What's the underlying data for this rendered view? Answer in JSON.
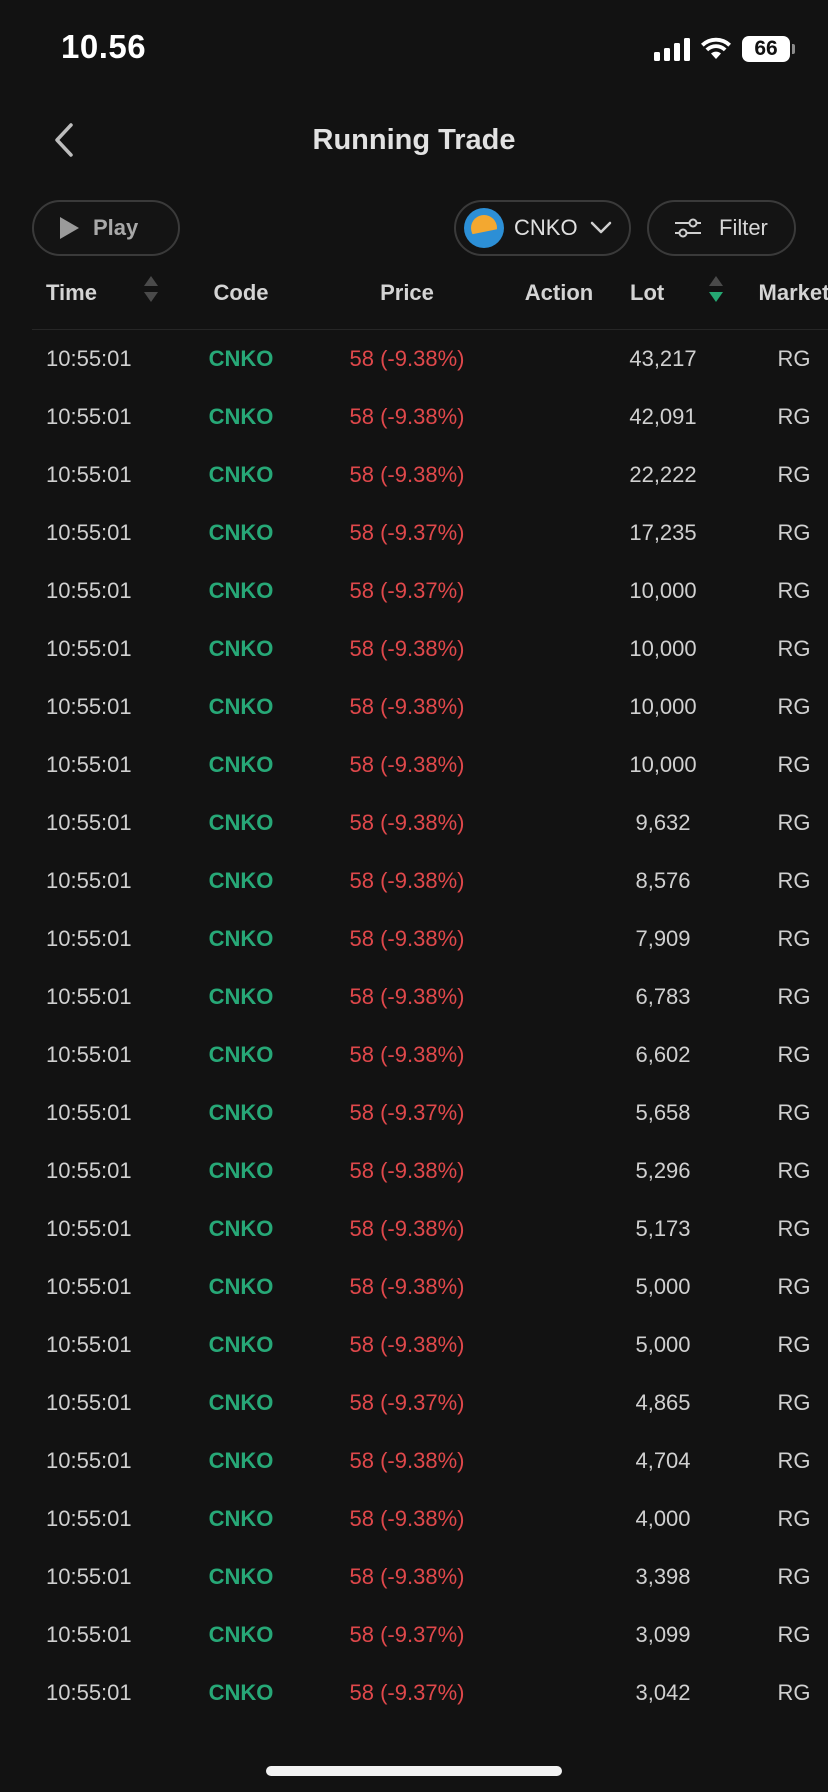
{
  "status_bar": {
    "time": "10.56",
    "battery": "66"
  },
  "header": {
    "title": "Running Trade"
  },
  "toolbar": {
    "play_label": "Play",
    "stock_label": "CNKO",
    "filter_label": "Filter"
  },
  "table": {
    "columns": {
      "time": "Time",
      "code": "Code",
      "price": "Price",
      "action": "Action",
      "lot": "Lot",
      "market": "Market"
    },
    "sort": {
      "column": "Lot",
      "direction": "descending"
    },
    "rows": [
      {
        "time": "10:55:01",
        "code": "CNKO",
        "price": "58 (-9.38%)",
        "action": "",
        "lot": "43,217",
        "market": "RG"
      },
      {
        "time": "10:55:01",
        "code": "CNKO",
        "price": "58 (-9.38%)",
        "action": "",
        "lot": "42,091",
        "market": "RG"
      },
      {
        "time": "10:55:01",
        "code": "CNKO",
        "price": "58 (-9.38%)",
        "action": "",
        "lot": "22,222",
        "market": "RG"
      },
      {
        "time": "10:55:01",
        "code": "CNKO",
        "price": "58 (-9.37%)",
        "action": "",
        "lot": "17,235",
        "market": "RG"
      },
      {
        "time": "10:55:01",
        "code": "CNKO",
        "price": "58 (-9.37%)",
        "action": "",
        "lot": "10,000",
        "market": "RG"
      },
      {
        "time": "10:55:01",
        "code": "CNKO",
        "price": "58 (-9.38%)",
        "action": "",
        "lot": "10,000",
        "market": "RG"
      },
      {
        "time": "10:55:01",
        "code": "CNKO",
        "price": "58 (-9.38%)",
        "action": "",
        "lot": "10,000",
        "market": "RG"
      },
      {
        "time": "10:55:01",
        "code": "CNKO",
        "price": "58 (-9.38%)",
        "action": "",
        "lot": "10,000",
        "market": "RG"
      },
      {
        "time": "10:55:01",
        "code": "CNKO",
        "price": "58 (-9.38%)",
        "action": "",
        "lot": "9,632",
        "market": "RG"
      },
      {
        "time": "10:55:01",
        "code": "CNKO",
        "price": "58 (-9.38%)",
        "action": "",
        "lot": "8,576",
        "market": "RG"
      },
      {
        "time": "10:55:01",
        "code": "CNKO",
        "price": "58 (-9.38%)",
        "action": "",
        "lot": "7,909",
        "market": "RG"
      },
      {
        "time": "10:55:01",
        "code": "CNKO",
        "price": "58 (-9.38%)",
        "action": "",
        "lot": "6,783",
        "market": "RG"
      },
      {
        "time": "10:55:01",
        "code": "CNKO",
        "price": "58 (-9.38%)",
        "action": "",
        "lot": "6,602",
        "market": "RG"
      },
      {
        "time": "10:55:01",
        "code": "CNKO",
        "price": "58 (-9.37%)",
        "action": "",
        "lot": "5,658",
        "market": "RG"
      },
      {
        "time": "10:55:01",
        "code": "CNKO",
        "price": "58 (-9.38%)",
        "action": "",
        "lot": "5,296",
        "market": "RG"
      },
      {
        "time": "10:55:01",
        "code": "CNKO",
        "price": "58 (-9.38%)",
        "action": "",
        "lot": "5,173",
        "market": "RG"
      },
      {
        "time": "10:55:01",
        "code": "CNKO",
        "price": "58 (-9.38%)",
        "action": "",
        "lot": "5,000",
        "market": "RG"
      },
      {
        "time": "10:55:01",
        "code": "CNKO",
        "price": "58 (-9.38%)",
        "action": "",
        "lot": "5,000",
        "market": "RG"
      },
      {
        "time": "10:55:01",
        "code": "CNKO",
        "price": "58 (-9.37%)",
        "action": "",
        "lot": "4,865",
        "market": "RG"
      },
      {
        "time": "10:55:01",
        "code": "CNKO",
        "price": "58 (-9.38%)",
        "action": "",
        "lot": "4,704",
        "market": "RG"
      },
      {
        "time": "10:55:01",
        "code": "CNKO",
        "price": "58 (-9.38%)",
        "action": "",
        "lot": "4,000",
        "market": "RG"
      },
      {
        "time": "10:55:01",
        "code": "CNKO",
        "price": "58 (-9.38%)",
        "action": "",
        "lot": "3,398",
        "market": "RG"
      },
      {
        "time": "10:55:01",
        "code": "CNKO",
        "price": "58 (-9.37%)",
        "action": "",
        "lot": "3,099",
        "market": "RG"
      },
      {
        "time": "10:55:01",
        "code": "CNKO",
        "price": "58 (-9.37%)",
        "action": "",
        "lot": "3,042",
        "market": "RG"
      }
    ]
  },
  "colors": {
    "background": "#121212",
    "code_green": "#27a877",
    "price_red": "#e0484b",
    "sort_active": "#25a873"
  },
  "icons": [
    "back-icon",
    "play-icon",
    "stock-logo-icon",
    "chevron-down-icon",
    "filter-icon",
    "sort-icon",
    "signal-icon",
    "wifi-icon",
    "battery-icon"
  ]
}
